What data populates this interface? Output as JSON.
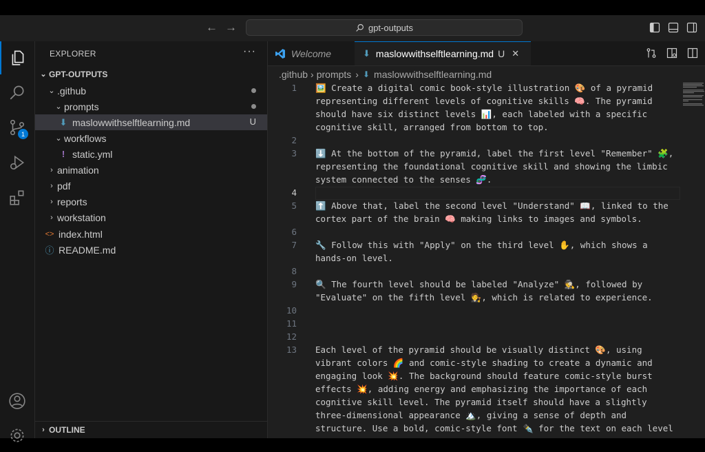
{
  "titlebar": {
    "search_text": "gpt-outputs"
  },
  "activity": {
    "scm_badge": "1"
  },
  "explorer": {
    "title": "EXPLORER",
    "more": "···",
    "root": "GPT-OUTPUTS",
    "items": [
      {
        "label": ".github",
        "indent": 1,
        "type": "folder-open",
        "status": "dot"
      },
      {
        "label": "prompts",
        "indent": 2,
        "type": "folder-open",
        "status": "dot"
      },
      {
        "label": "maslowwithselftlearning.md",
        "indent": 3,
        "type": "md",
        "status": "U",
        "selected": true
      },
      {
        "label": "workflows",
        "indent": 2,
        "type": "folder-open"
      },
      {
        "label": "static.yml",
        "indent": 3,
        "type": "yml"
      },
      {
        "label": "animation",
        "indent": 1,
        "type": "folder"
      },
      {
        "label": "pdf",
        "indent": 1,
        "type": "folder"
      },
      {
        "label": "reports",
        "indent": 1,
        "type": "folder"
      },
      {
        "label": "workstation",
        "indent": 1,
        "type": "folder"
      },
      {
        "label": "index.html",
        "indent": 1,
        "type": "html"
      },
      {
        "label": "README.md",
        "indent": 1,
        "type": "info"
      }
    ],
    "outline": "OUTLINE"
  },
  "tabs": {
    "welcome": "Welcome",
    "active": "maslowwithselftlearning.md",
    "active_status": "U",
    "close": "✕"
  },
  "breadcrumb": {
    "part1": ".github",
    "part2": "prompts",
    "part3": "maslowwithselftlearning.md"
  },
  "editor": {
    "current_line": "4",
    "lines": [
      {
        "n": "1",
        "rows": [
          "🖼️ Create a digital comic book-style illustration 🎨 of a pyramid",
          "representing different levels of cognitive skills 🧠. The pyramid",
          "should have six distinct levels 📊, each labeled with a specific",
          "cognitive skill, arranged from bottom to top."
        ]
      },
      {
        "n": "2",
        "rows": [
          ""
        ]
      },
      {
        "n": "3",
        "rows": [
          "⬇️ At the bottom of the pyramid, label the first level \"Remember\" 🧩,",
          "representing the foundational cognitive skill and showing the limbic",
          "system connected to the senses 🧬."
        ]
      },
      {
        "n": "4",
        "rows": [
          ""
        ]
      },
      {
        "n": "5",
        "rows": [
          "⬆️ Above that, label the second level \"Understand\" 📖, linked to the",
          "cortex part of the brain 🧠 making links to images and symbols."
        ]
      },
      {
        "n": "6",
        "rows": [
          ""
        ]
      },
      {
        "n": "7",
        "rows": [
          "🔧 Follow this with \"Apply\" on the third level ✋, which shows a",
          "hands-on level."
        ]
      },
      {
        "n": "8",
        "rows": [
          ""
        ]
      },
      {
        "n": "9",
        "rows": [
          "🔍 The fourth level should be labeled \"Analyze\" 🕵️, followed by",
          "\"Evaluate\" on the fifth level 🧑‍⚖️, which is related to experience."
        ]
      },
      {
        "n": "10",
        "rows": [
          ""
        ]
      },
      {
        "n": "11",
        "rows": [
          ""
        ]
      },
      {
        "n": "12",
        "rows": [
          ""
        ]
      },
      {
        "n": "13",
        "rows": [
          "Each level of the pyramid should be visually distinct 🎨, using",
          "vibrant colors 🌈 and comic-style shading to create a dynamic and",
          "engaging look 💥. The background should feature comic-style burst",
          "effects 💥, adding energy and emphasizing the importance of each",
          "cognitive skill level. The pyramid itself should have a slightly",
          "three-dimensional appearance 🏔️, giving a sense of depth and",
          "structure. Use a bold, comic-style font ✒️ for the text on each level"
        ]
      }
    ]
  }
}
